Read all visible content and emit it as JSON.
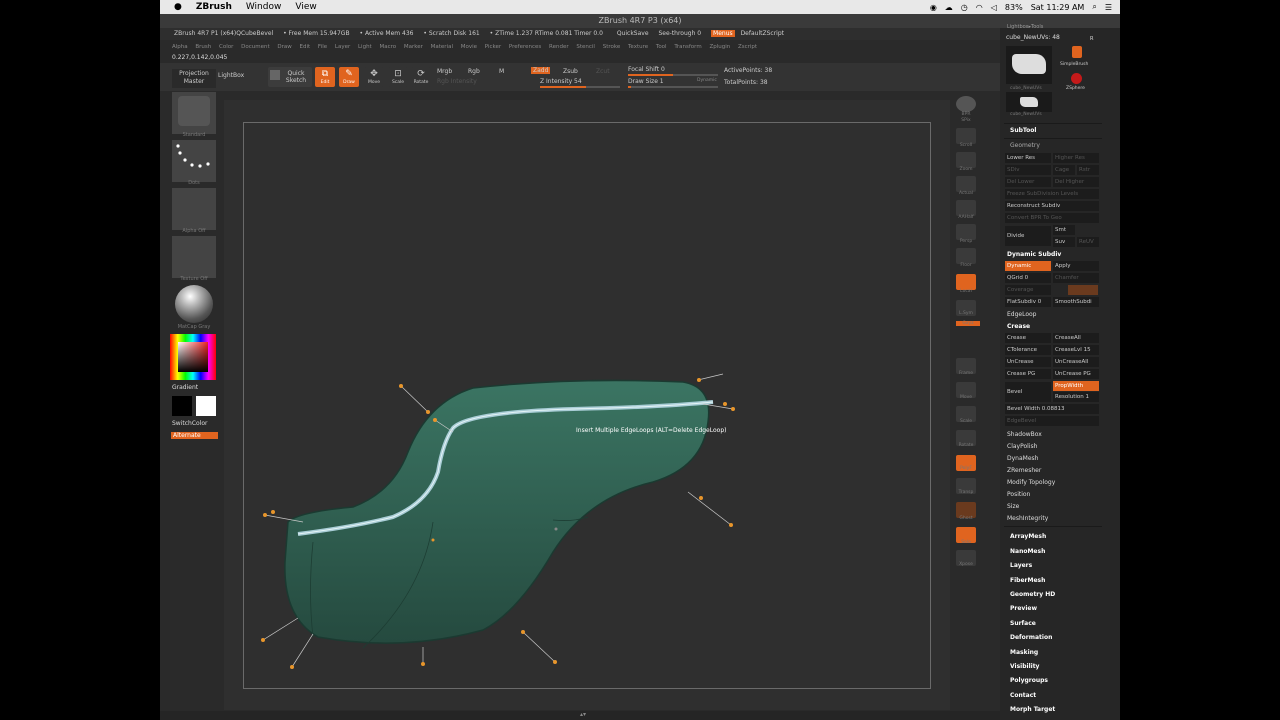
{
  "menubar": {
    "app_name": "ZBrush",
    "items": [
      "Window",
      "View"
    ],
    "battery": "83%",
    "clock": "Sat 11:29 AM"
  },
  "title": "ZBrush 4R7 P3 (x64)",
  "infobar": {
    "app": "ZBrush 4R7 P1 (x64)QCubeBevel",
    "free_mem": "• Free Mem 15.947GB",
    "active_mem": "• Active Mem 436",
    "scratch": "• Scratch Disk 161",
    "ztime": "• ZTime 1.237 RTime 0.081 Timer 0.0",
    "quicksave": "QuickSave",
    "seethrough": "See-through 0",
    "menus": "Menus",
    "script": "DefaultZScript"
  },
  "menus": [
    "Alpha",
    "Brush",
    "Color",
    "Document",
    "Draw",
    "Edit",
    "File",
    "Layer",
    "Light",
    "Macro",
    "Marker",
    "Material",
    "Movie",
    "Picker",
    "Preferences",
    "Render",
    "Stencil",
    "Stroke",
    "Texture",
    "Tool",
    "Transform",
    "Zplugin",
    "Zscript"
  ],
  "coords": "0.227,0.142,0.045",
  "toolbar": {
    "projection_master": "Projection Master",
    "lightbox": "LightBox",
    "quick_sketch": "Quick Sketch",
    "edit": "Edit",
    "draw": "Draw",
    "move": "Move",
    "scale": "Scale",
    "rotate": "Rotate",
    "mrgb": "Mrgb",
    "rgb": "Rgb",
    "m": "M",
    "rgb_intensity": "Rgb Intensity",
    "zadd": "Zadd",
    "zsub": "Zsub",
    "zcut": "Zcut",
    "z_intensity": "Z Intensity 54",
    "focal_shift": "Focal Shift 0",
    "draw_size": "Draw Size 1",
    "dynamic": "Dynamic",
    "active_points": "ActivePoints: 38",
    "total_points": "TotalPoints: 38"
  },
  "leftshelf": {
    "labels": [
      "Standard",
      "Dots",
      "Alpha Off",
      "Texture Off",
      "MatCap Gray"
    ],
    "gradient": "Gradient",
    "switchcolor": "SwitchColor",
    "alternate": "Alternate"
  },
  "tooltip": "Insert Multiple EdgeLoops (ALT=Delete EdgeLoop)",
  "right_icons": [
    "BPR",
    "SPix",
    "Scroll",
    "Zoom",
    "Actual",
    "AAHalf",
    "Persp",
    "Floor",
    "Local",
    "L.Sym",
    "Gxyz",
    "Frame",
    "Move",
    "Scale",
    "Rotate",
    "PolyF",
    "Transp",
    "Ghost",
    "Solo",
    "Xpose"
  ],
  "panel": {
    "lightbox_tools": "Lightbox▸Tools",
    "current_tool": "cube_NewUVs: 48",
    "r": "R",
    "tool_thumbs": [
      "cube_NewUVs",
      "SimpleBrush",
      "ZSphere",
      "cube_NewUVs"
    ],
    "subtool": "SubTool",
    "geometry": "Geometry",
    "lower_res": "Lower Res",
    "higher_res": "Higher Res",
    "sdiv": "SDiv",
    "cage": "Cage",
    "rstr": "Rstr",
    "del_lower": "Del Lower",
    "del_higher": "Del Higher",
    "freeze": "Freeze SubDivision Levels",
    "reconstruct": "Reconstruct Subdiv",
    "convert_bpr": "Convert BPR To Geo",
    "divide": "Divide",
    "smt": "Smt",
    "suv": "Suv",
    "reuv": "ReUV",
    "dynamic_subdiv": "Dynamic Subdiv",
    "dynamic": "Dynamic",
    "apply": "Apply",
    "qgrid": "QGrid 0",
    "chamfer": "Chamfer",
    "coverage": "Coverage",
    "flatsubdiv": "FlatSubdiv 0",
    "smoothsubdiv": "SmoothSubdi",
    "edgeloop": "EdgeLoop",
    "crease_hdr": "Crease",
    "crease": "Crease",
    "creaseall": "CreaseAll",
    "ctolerance": "CTolerance",
    "creaselvl": "CreaseLvl 15",
    "uncrease": "UnCrease",
    "uncreaseall": "UnCreaseAll",
    "crease_pg": "Crease PG",
    "uncrease_pg": "UnCrease PG",
    "bevel": "Bevel",
    "propwidth": "PropWidth",
    "resolution": "Resolution 1",
    "bevel_width": "Bevel Width 0.08813",
    "edgebevel": "EdgeBevel",
    "subpalettes": [
      "ShadowBox",
      "ClayPolish",
      "DynaMesh",
      "ZRemesher",
      "Modify Topology",
      "Position",
      "Size",
      "MeshIntegrity"
    ],
    "sections": [
      "ArrayMesh",
      "NanoMesh",
      "Layers",
      "FiberMesh",
      "Geometry HD",
      "Preview",
      "Surface",
      "Deformation",
      "Masking",
      "Visibility",
      "Polygroups",
      "Contact",
      "Morph Target"
    ]
  },
  "colors": {
    "accent": "#e0641f",
    "mesh": "#2f5e4e",
    "edgeloop": "#a9cdd6"
  }
}
